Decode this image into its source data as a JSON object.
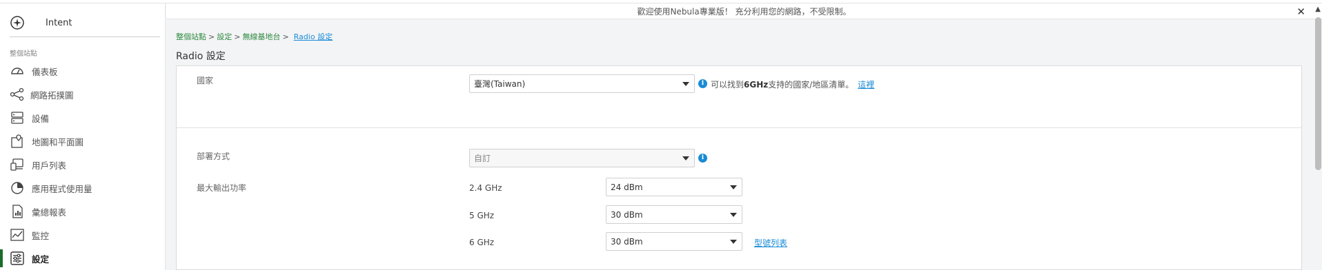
{
  "sidebar": {
    "intent_label": "Intent",
    "section_label": "整個站點",
    "items": [
      {
        "label": "儀表板",
        "icon": "gauge-icon"
      },
      {
        "label": "網路拓撲圖",
        "icon": "topology-icon"
      },
      {
        "label": "設備",
        "icon": "server-icon"
      },
      {
        "label": "地圖和平面圖",
        "icon": "map-pin-icon"
      },
      {
        "label": "用戶列表",
        "icon": "clients-icon"
      },
      {
        "label": "應用程式使用量",
        "icon": "pie-chart-icon"
      },
      {
        "label": "彙總報表",
        "icon": "report-icon"
      },
      {
        "label": "監控",
        "icon": "line-chart-icon"
      },
      {
        "label": "設定",
        "icon": "sliders-icon"
      }
    ],
    "active_index": 8
  },
  "banner": {
    "text": "歡迎使用Nebula專業版！ 充分利用您的網路，不受限制。",
    "close": "✕"
  },
  "breadcrumb": {
    "items": [
      "整個站點",
      "設定",
      "無線基地台"
    ],
    "separator": ">",
    "current": "Radio 設定"
  },
  "page_title": "Radio 設定",
  "form": {
    "country": {
      "label": "國家",
      "value": "臺灣(Taiwan)",
      "note_prefix": "可以找到",
      "note_bold": "6GHz",
      "note_suffix": "支持的國家/地區清單。",
      "note_link": "這裡"
    },
    "deployment": {
      "label": "部署方式",
      "value": "自訂"
    },
    "max_power": {
      "label": "最大輸出功率",
      "bands": [
        {
          "band": "2.4 GHz",
          "value": "24 dBm"
        },
        {
          "band": "5 GHz",
          "value": "30 dBm"
        },
        {
          "band": "6 GHz",
          "value": "30 dBm"
        }
      ],
      "model_list_link": "型號列表"
    }
  },
  "colors": {
    "accent_green": "#1c6b2a",
    "link_blue": "#1a8bd6",
    "breadcrumb_green": "#2d8a3e"
  }
}
